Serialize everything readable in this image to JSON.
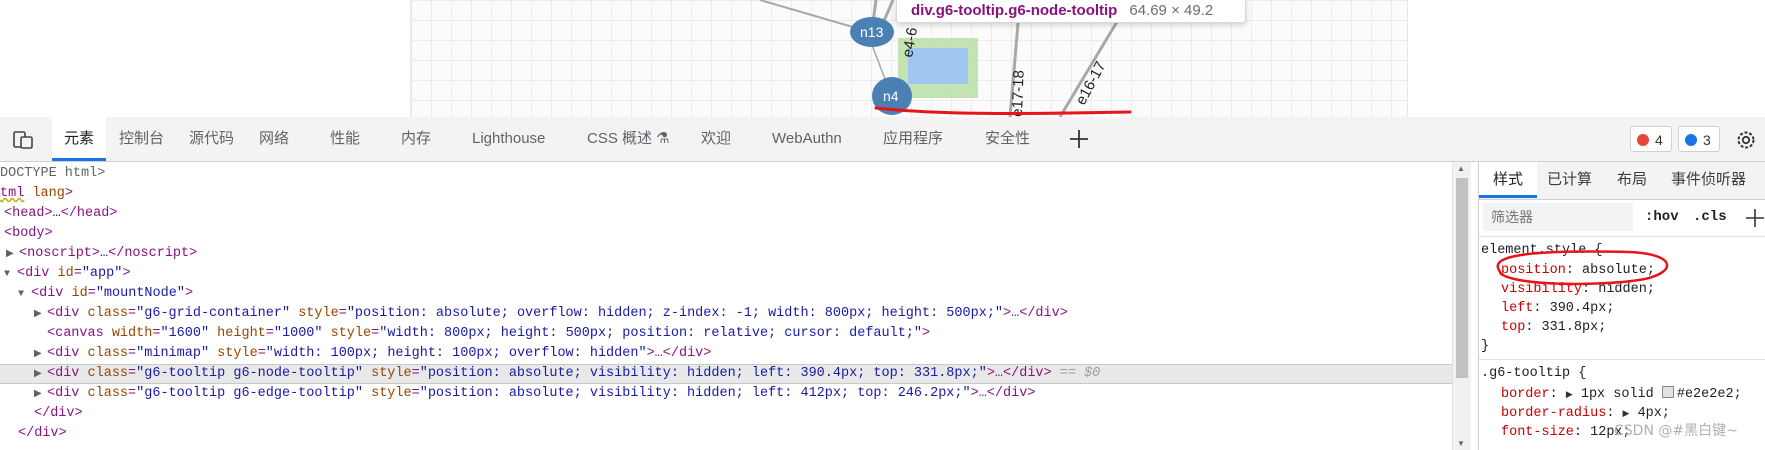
{
  "graph": {
    "nodes": [
      {
        "id": "n13",
        "label": "n13"
      },
      {
        "id": "n4",
        "label": "n4"
      }
    ],
    "edge_labels": [
      "e4-6",
      "e17-18",
      "e16-17"
    ],
    "inspect_tooltip": {
      "selector": "div.g6-tooltip.g6-node-tooltip",
      "size": "64.69 × 49.2"
    }
  },
  "tabbar": {
    "tabs": [
      "元素",
      "控制台",
      "源代码",
      "网络",
      "性能",
      "内存",
      "Lighthouse",
      "CSS 概述 ⚗",
      "欢迎",
      "WebAuthn",
      "应用程序",
      "安全性"
    ],
    "errors_count": "4",
    "messages_count": "3"
  },
  "elements": {
    "lines": {
      "l0": {
        "text": "DOCTYPE html>"
      },
      "l1": {
        "tag": "tml",
        "attr": "lang",
        "close": ">"
      },
      "l2": {
        "open": "<head>",
        "ellipsis": "…",
        "close": "</head>"
      },
      "l3": {
        "text": "<body>"
      },
      "l4": {
        "open": "<noscript>",
        "ellipsis": "…",
        "close": "</noscript>"
      },
      "l5": {
        "tag": "<div",
        "attr": "id",
        "val": "\"app\"",
        "close": ">"
      },
      "l6": {
        "tag": "<div",
        "attr": "id",
        "val": "\"mountNode\"",
        "close": ">"
      },
      "l7": {
        "tag": "<div",
        "a1": "class",
        "v1": "\"g6-grid-container\"",
        "a2": "style",
        "v2": "\"position: absolute; overflow: hidden; z-index: -1; width: 800px; height: 500px;\"",
        "rest": ">…</div>"
      },
      "l8": {
        "tag": "<canvas",
        "a1": "width",
        "v1": "\"1600\"",
        "a2": "height",
        "v2": "\"1000\"",
        "a3": "style",
        "v3": "\"width: 800px; height: 500px; position: relative; cursor: default;\"",
        "rest": ">"
      },
      "l9": {
        "tag": "<div",
        "a1": "class",
        "v1": "\"minimap\"",
        "a2": "style",
        "v2": "\"width: 100px; height: 100px; overflow: hidden\"",
        "rest": ">…</div>"
      },
      "l10": {
        "tag": "<div",
        "a1": "class",
        "v1": "\"g6-tooltip g6-node-tooltip\"",
        "a2": "style",
        "v2": "\"position: absolute; visibility: hidden; left: 390.4px; top: 331.8px;\"",
        "rest": ">…</div>",
        "marker": "== $0"
      },
      "l11": {
        "tag": "<div",
        "a1": "class",
        "v1": "\"g6-tooltip g6-edge-tooltip\"",
        "a2": "style",
        "v2": "\"position: absolute; visibility: hidden; left: 412px; top: 246.2px;\"",
        "rest": ">…</div>"
      },
      "l12": {
        "text": "</div>"
      },
      "l13": {
        "text": "</div>"
      }
    }
  },
  "styles": {
    "tabs": [
      "样式",
      "已计算",
      "布局",
      "事件侦听器"
    ],
    "filter_placeholder": "筛选器",
    "hov": ":hov",
    "cls": ".cls",
    "element_style": {
      "selector": "element.style {",
      "props": [
        {
          "name": "position",
          "value": "absolute;"
        },
        {
          "name": "visibility",
          "value": "hidden;"
        },
        {
          "name": "left",
          "value": "390.4px;"
        },
        {
          "name": "top",
          "value": "331.8px;"
        }
      ],
      "close": "}"
    },
    "g6_tooltip": {
      "selector": ".g6-tooltip {",
      "props": [
        {
          "name": "border",
          "value": "1px solid ",
          "extra": "#e2e2e2;"
        },
        {
          "name": "border-radius",
          "value": "4px;"
        },
        {
          "name": "font-size",
          "value": "12px;"
        }
      ]
    }
  },
  "watermark": "CSDN @#黑白键~",
  "colors": {
    "accent": "#1a73e8",
    "annotation": "#e8141b",
    "node": "#4b80b3",
    "error": "#e8453c",
    "message": "#1a73e8"
  }
}
